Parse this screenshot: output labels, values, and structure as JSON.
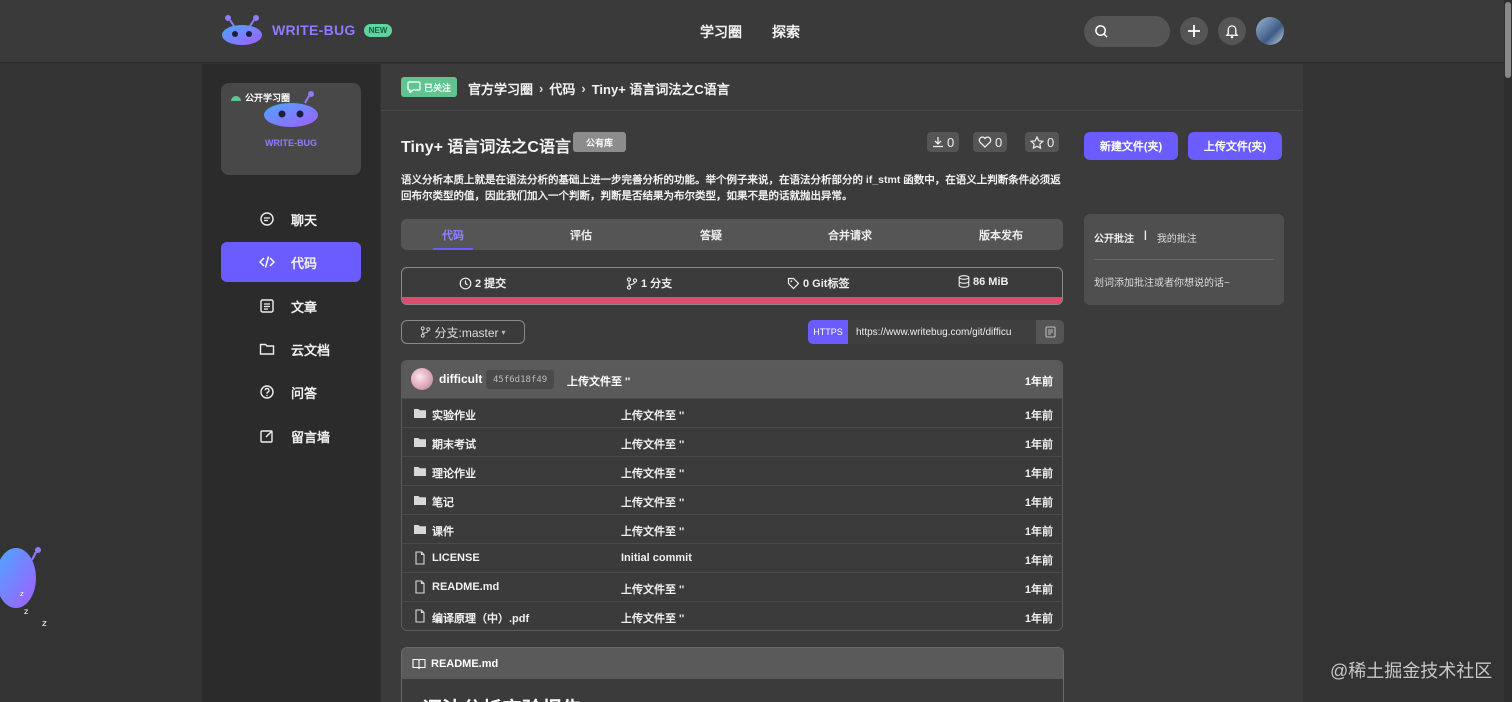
{
  "brand": {
    "name": "WRITE-BUG",
    "badge": "NEW"
  },
  "nav": {
    "links": [
      "学习圈",
      "探索"
    ]
  },
  "sidebar": {
    "circle_tag": "公开学习圈",
    "circle_brand": "WRITE-BUG",
    "items": [
      {
        "label": "聊天",
        "icon": "chat-icon"
      },
      {
        "label": "代码",
        "icon": "code-icon",
        "active": true
      },
      {
        "label": "文章",
        "icon": "article-icon"
      },
      {
        "label": "云文档",
        "icon": "folder-icon"
      },
      {
        "label": "问答",
        "icon": "question-icon"
      },
      {
        "label": "留言墙",
        "icon": "edit-icon"
      }
    ]
  },
  "breadcrumb": {
    "follow": "已关注",
    "items": [
      "官方学习圈",
      "代码",
      "Tiny+ 语言词法之C语言"
    ]
  },
  "repo": {
    "title": "Tiny+ 语言词法之C语言",
    "visibility": "公有库",
    "downloads": "0",
    "likes": "0",
    "stars": "0",
    "new_file": "新建文件(夹)",
    "upload_file": "上传文件(夹)",
    "description": "语义分析本质上就是在语法分析的基础上进一步完善分析的功能。举个例子来说，在语法分析部分的 if_stmt 函数中，在语义上判断条件必须返回布尔类型的值，因此我们加入一个判断，判断是否结果为布尔类型，如果不是的话就抛出异常。"
  },
  "tabs": [
    "代码",
    "评估",
    "答疑",
    "合并请求",
    "版本发布"
  ],
  "stats": {
    "commits": "2 提交",
    "branches": "1 分支",
    "tags": "0 Git标签",
    "size": "86 MiB"
  },
  "branch": {
    "label": "分支:master"
  },
  "clone": {
    "protocol": "HTTPS",
    "url": "https://www.writebug.com/git/difficu"
  },
  "latest_commit": {
    "user": "difficult",
    "hash": "45f6d18f49",
    "message": "上传文件至 ''",
    "time": "1年前"
  },
  "files": [
    {
      "type": "folder",
      "name": "实验作业",
      "message": "上传文件至 ''",
      "time": "1年前"
    },
    {
      "type": "folder",
      "name": "期末考试",
      "message": "上传文件至 ''",
      "time": "1年前"
    },
    {
      "type": "folder",
      "name": "理论作业",
      "message": "上传文件至 ''",
      "time": "1年前"
    },
    {
      "type": "folder",
      "name": "笔记",
      "message": "上传文件至 ''",
      "time": "1年前"
    },
    {
      "type": "folder",
      "name": "课件",
      "message": "上传文件至 ''",
      "time": "1年前"
    },
    {
      "type": "file",
      "name": "LICENSE",
      "message": "Initial commit",
      "time": "1年前"
    },
    {
      "type": "file",
      "name": "README.md",
      "message": "上传文件至 ''",
      "time": "1年前"
    },
    {
      "type": "file",
      "name": "编译原理（中）.pdf",
      "message": "上传文件至 ''",
      "time": "1年前"
    }
  ],
  "readme": {
    "title": "README.md",
    "heading": "词法分析实验报告"
  },
  "annotations": {
    "public": "公开批注",
    "sep": "|",
    "mine": "我的批注",
    "placeholder": "划词添加批注或者你想说的话~"
  },
  "watermark": "@稀土掘金技术社区",
  "colors": {
    "accent": "#6a5cff",
    "follow": "#61c48f",
    "progress": "#e04a6c"
  }
}
